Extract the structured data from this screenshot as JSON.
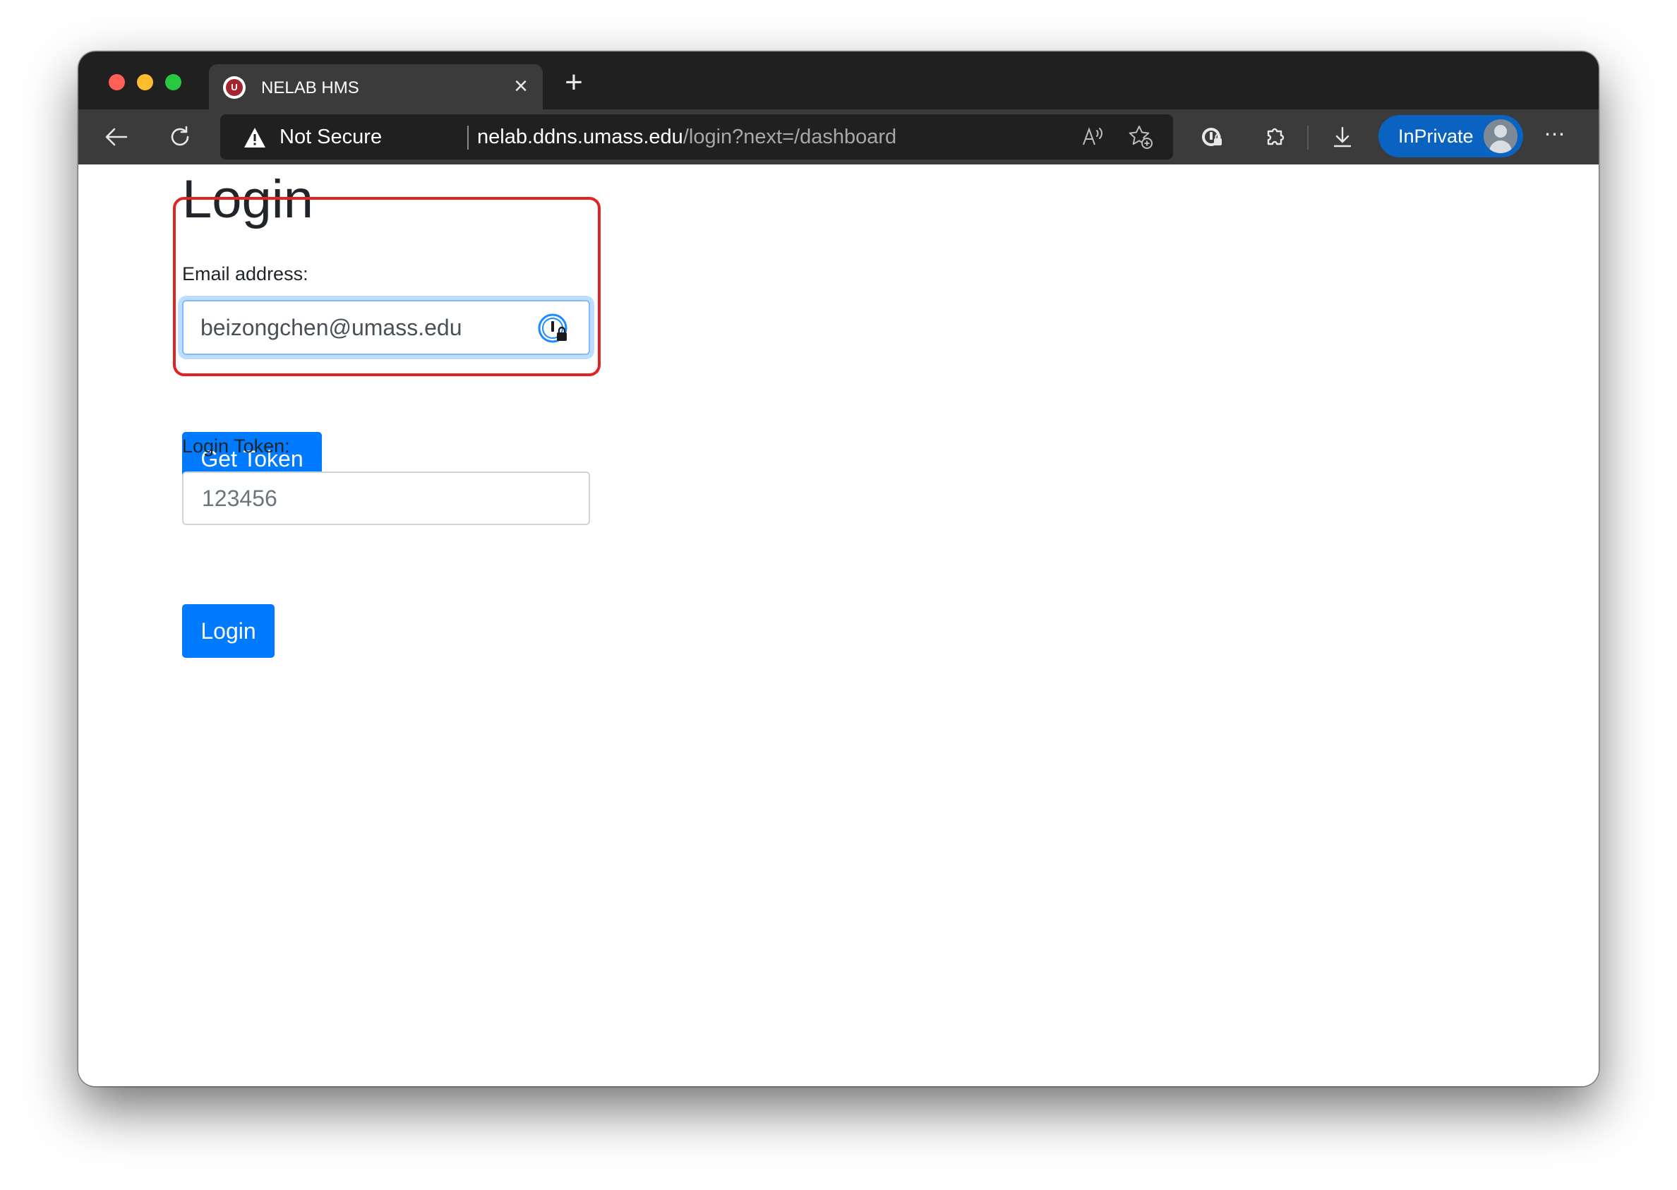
{
  "browser": {
    "tab": {
      "title": "NELAB HMS",
      "favicon": "umass-seal-icon",
      "close_icon": "×"
    },
    "new_tab_icon": "+",
    "toolbar": {
      "security_label": "Not Secure",
      "url_host": "nelab.ddns.umass.edu",
      "url_path": "/login?next=/dashboard",
      "inprivate_label": "InPrivate",
      "more_icon": "⋯"
    }
  },
  "page": {
    "title": "Login",
    "email": {
      "label": "Email address:",
      "value": "beizongchen@umass.edu"
    },
    "get_token_button": "Get Token",
    "token": {
      "label": "Login Token:",
      "placeholder": "123456",
      "value": ""
    },
    "login_button": "Login"
  },
  "colors": {
    "primary_button": "#007bff",
    "highlight_annotation": "#e02424",
    "inprivate_badge": "#0b63c1"
  }
}
